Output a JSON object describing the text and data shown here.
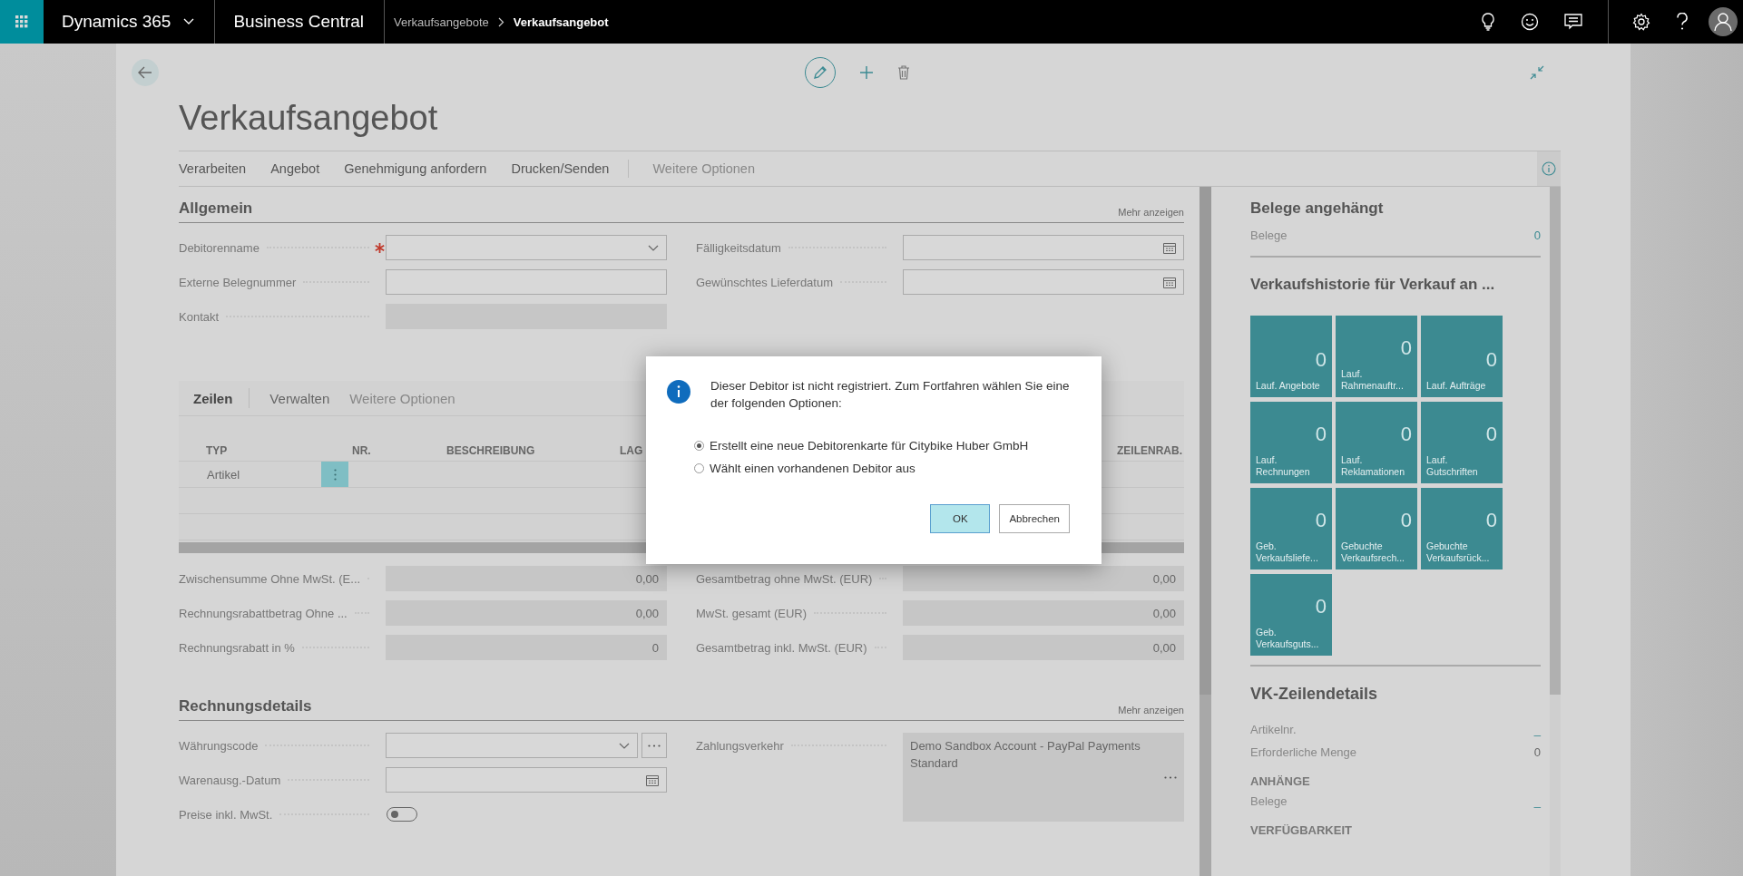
{
  "app_bar": {
    "product": "Dynamics 365",
    "app": "Business Central",
    "breadcrumb": [
      {
        "label": "Verkaufsangebote",
        "current": false
      },
      {
        "label": "Verkaufsangebot",
        "current": true
      }
    ]
  },
  "page": {
    "title": "Verkaufsangebot",
    "actions": [
      "Verarbeiten",
      "Angebot",
      "Genehmigung anfordern",
      "Drucken/Senden"
    ],
    "more_actions": "Weitere Optionen"
  },
  "general": {
    "title": "Allgemein",
    "show_more": "Mehr anzeigen",
    "left_fields": [
      {
        "label": "Debitorenname",
        "kind": "dropdown",
        "required": true
      },
      {
        "label": "Externe Belegnummer",
        "kind": "text",
        "required": false
      },
      {
        "label": "Kontakt",
        "kind": "readonly",
        "required": false
      }
    ],
    "right_fields": [
      {
        "label": "Fälligkeitsdatum",
        "kind": "date",
        "required": false
      },
      {
        "label": "Gewünschtes Lieferdatum",
        "kind": "date",
        "required": false
      }
    ]
  },
  "lines": {
    "tabs": [
      {
        "label": "Zeilen",
        "selected": true
      },
      {
        "label": "Verwalten",
        "selected": false
      },
      {
        "label": "Weitere Optionen",
        "selected": false
      }
    ],
    "columns": [
      "TYP",
      "NR.",
      "BESCHREIBUNG",
      "LAG"
    ],
    "last_column": "ZEILENRAB.",
    "rows": [
      {
        "type": "Artikel"
      }
    ]
  },
  "totals": {
    "left": [
      {
        "label": "Zwischensumme Ohne MwSt. (E...",
        "value": "0,00"
      },
      {
        "label": "Rechnungsrabattbetrag Ohne ...",
        "value": "0,00"
      },
      {
        "label": "Rechnungsrabatt in %",
        "value": "0"
      }
    ],
    "right": [
      {
        "label": "Gesamtbetrag ohne MwSt. (EUR)",
        "value": "0,00"
      },
      {
        "label": "MwSt. gesamt (EUR)",
        "value": "0,00"
      },
      {
        "label": "Gesamtbetrag inkl. MwSt. (EUR)",
        "value": "0,00"
      }
    ]
  },
  "invoice": {
    "title": "Rechnungsdetails",
    "show_more": "Mehr anzeigen",
    "left_fields": [
      {
        "label": "Währungscode",
        "kind": "dropdown_lookup"
      },
      {
        "label": "Warenausg.-Datum",
        "kind": "date"
      },
      {
        "label": "Preise inkl. MwSt.",
        "kind": "toggle",
        "on": false
      }
    ],
    "right_fields": [
      {
        "label": "Zahlungsverkehr",
        "kind": "memo",
        "value": "Demo Sandbox Account - PayPal Payments Standard"
      }
    ]
  },
  "factbox": {
    "attached": {
      "title": "Belege angehängt",
      "label": "Belege",
      "value": "0"
    },
    "history": {
      "title": "Verkaufshistorie für Verkauf an ...",
      "tiles": [
        {
          "value": "0",
          "label": "Lauf. Angebote"
        },
        {
          "value": "0",
          "label": "Lauf. Rahmenauftr..."
        },
        {
          "value": "0",
          "label": "Lauf. Aufträge"
        },
        {
          "value": "0",
          "label": "Lauf. Rechnungen"
        },
        {
          "value": "0",
          "label": "Lauf. Reklamationen"
        },
        {
          "value": "0",
          "label": "Lauf. Gutschriften"
        },
        {
          "value": "0",
          "label": "Geb. Verkaufsliefe..."
        },
        {
          "value": "0",
          "label": "Gebuchte Verkaufsrech..."
        },
        {
          "value": "0",
          "label": "Gebuchte Verkaufsrück..."
        },
        {
          "value": "0",
          "label": "Geb. Verkaufsguts..."
        }
      ]
    },
    "line_details": {
      "title": "VK-Zeilendetails",
      "rows": [
        {
          "label": "Artikelnr.",
          "value": "_"
        },
        {
          "label": "Erforderliche Menge",
          "value": "0"
        }
      ],
      "groups": [
        {
          "title": "ANHÄNGE",
          "rows": [
            {
              "label": "Belege",
              "value": "_"
            }
          ]
        },
        {
          "title": "VERFÜGBARKEIT"
        }
      ]
    }
  },
  "dialog": {
    "message": "Dieser Debitor ist nicht registriert. Zum Fortfahren wählen Sie eine der folgenden Optionen:",
    "options": [
      {
        "label": "Erstellt eine neue Debitorenkarte für Citybike Huber GmbH",
        "selected": true
      },
      {
        "label": "Wählt einen vorhandenen Debitor aus",
        "selected": false
      }
    ],
    "buttons": [
      {
        "label": "OK",
        "kind": "primary"
      },
      {
        "label": "Abbrechen",
        "kind": "secondary"
      }
    ]
  }
}
